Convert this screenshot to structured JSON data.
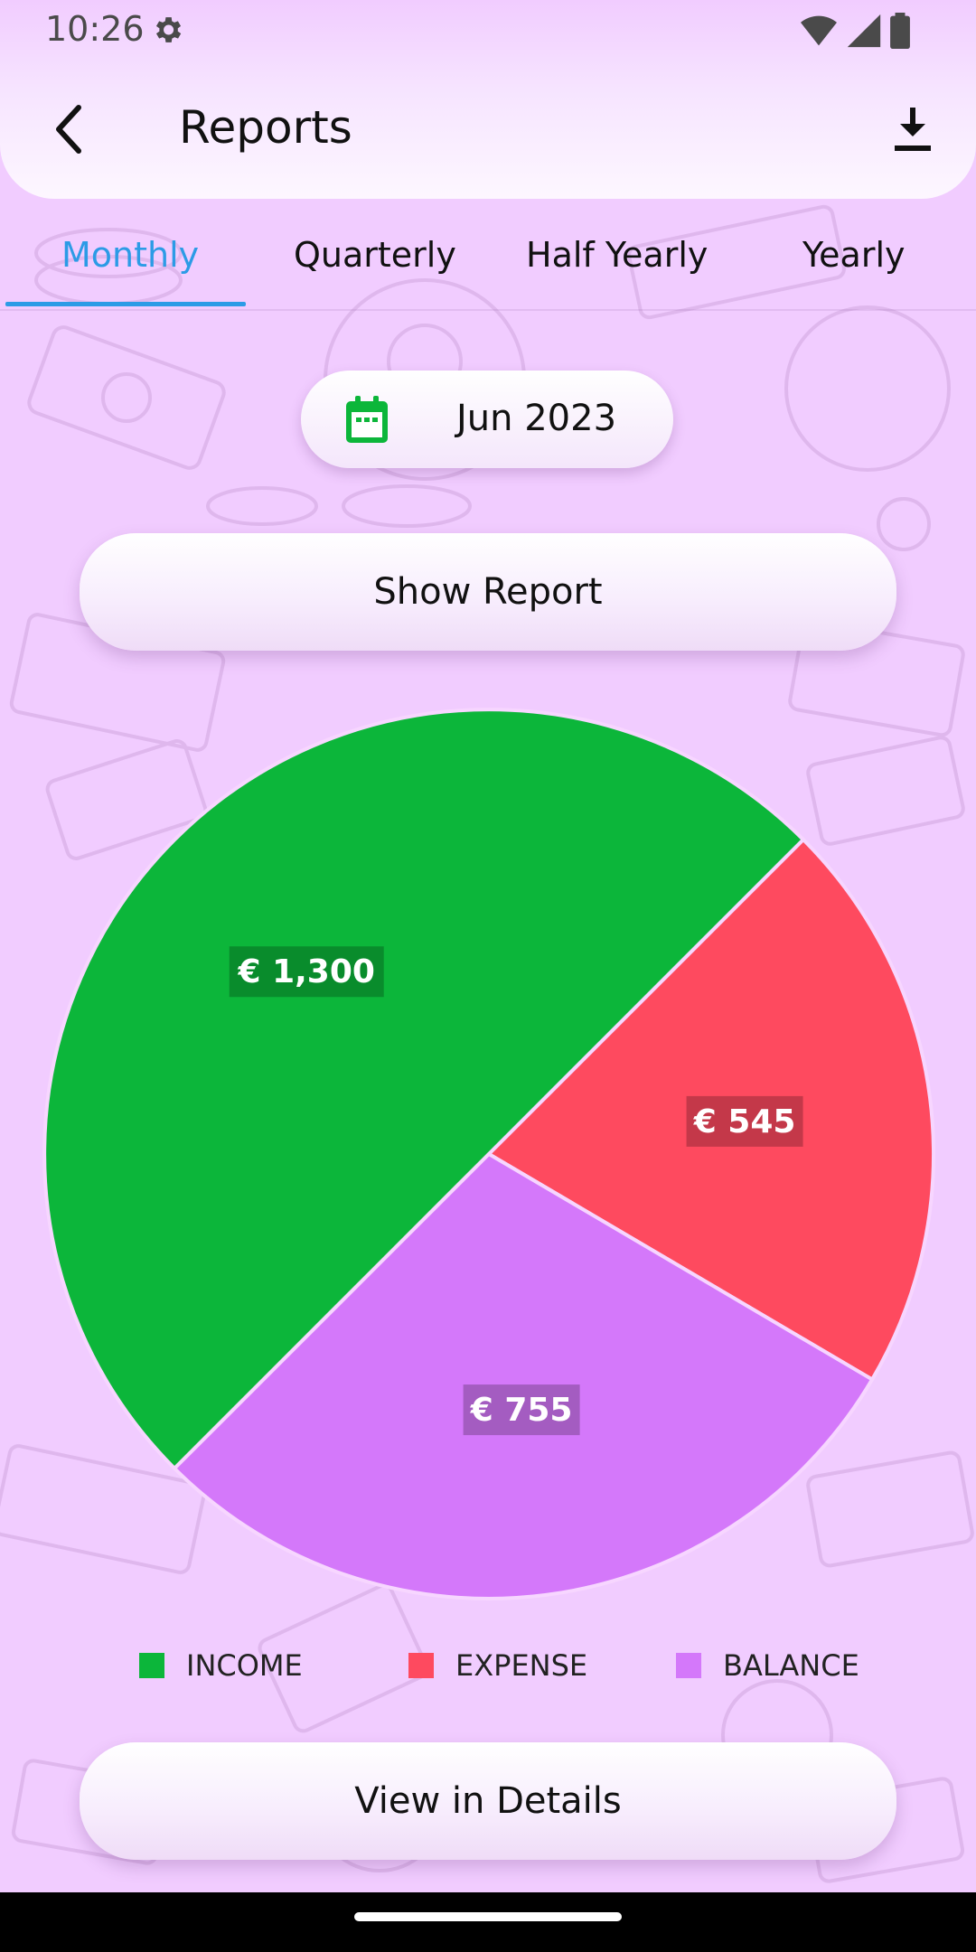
{
  "status_bar": {
    "time": "10:26",
    "icons": [
      "gear-icon",
      "wifi-icon",
      "signal-icon",
      "battery-icon"
    ]
  },
  "header": {
    "title": "Reports",
    "back_icon": "chevron-left-icon",
    "download_icon": "download-icon"
  },
  "tabs": [
    {
      "label": "Monthly",
      "active": true
    },
    {
      "label": "Quarterly",
      "active": false
    },
    {
      "label": "Half Yearly",
      "active": false
    },
    {
      "label": "Yearly",
      "active": false
    }
  ],
  "date_picker": {
    "icon": "calendar-icon",
    "value": "Jun 2023"
  },
  "show_report_label": "Show Report",
  "view_details_label": "View in Details",
  "colors": {
    "accent": "#2c9be6",
    "income": "#0cb63a",
    "expense": "#fe4a5f",
    "balance": "#d478fa",
    "background": "#f1ccff"
  },
  "chart_data": {
    "type": "pie",
    "categories": [
      "INCOME",
      "EXPENSE",
      "BALANCE"
    ],
    "values": [
      1300,
      545,
      755
    ],
    "value_labels": [
      "€ 1,300",
      "€ 545",
      "€ 755"
    ],
    "colors": [
      "#0cb63a",
      "#fe4a5f",
      "#d478fa"
    ],
    "legend_position": "bottom"
  }
}
